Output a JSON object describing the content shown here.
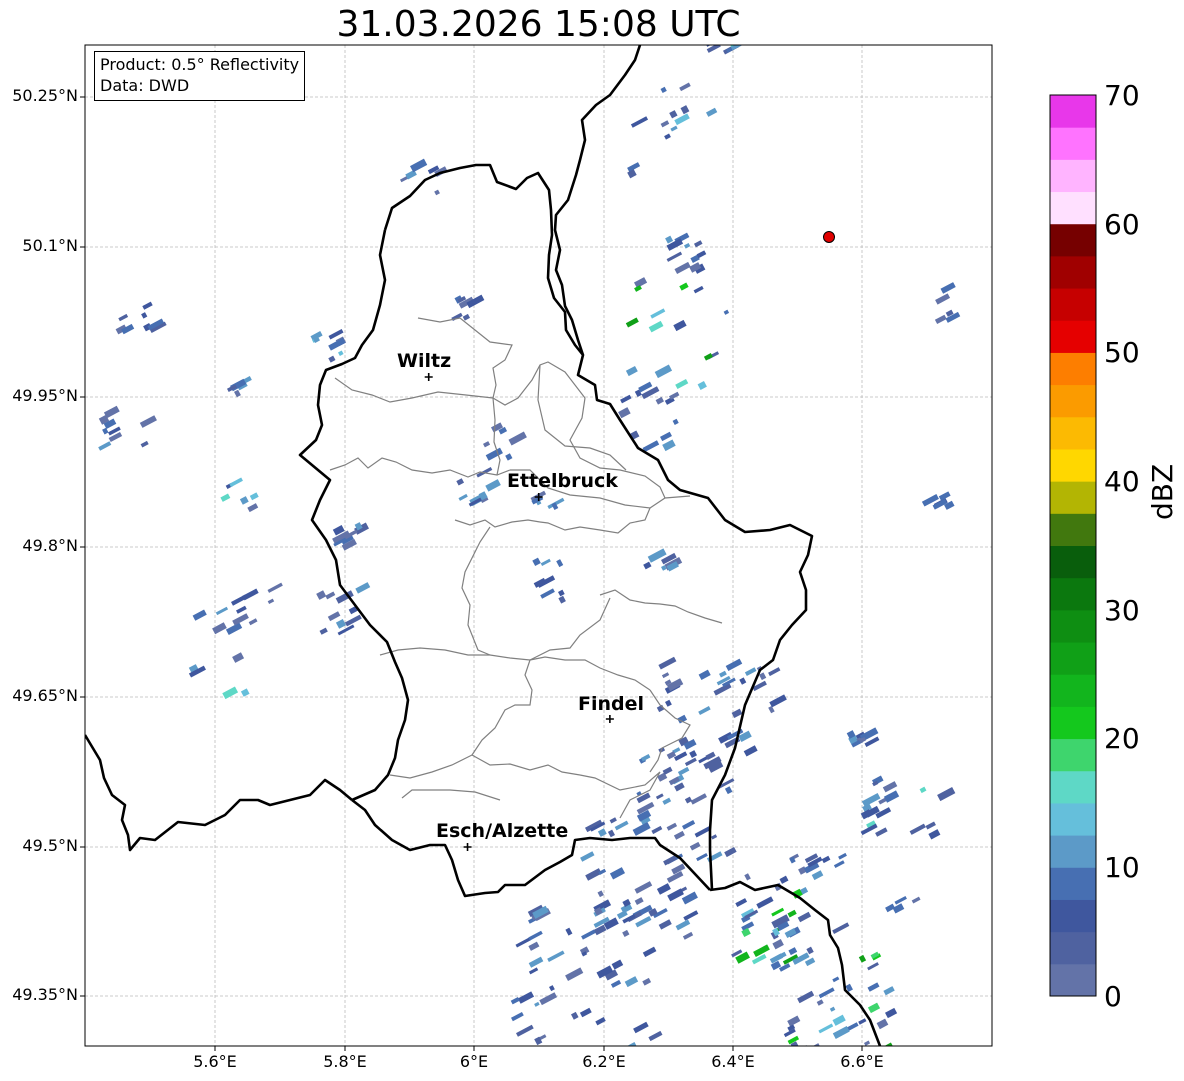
{
  "title": "31.03.2026 15:08 UTC",
  "info": {
    "line1": "Product: 0.5° Reflectivity",
    "line2": "Data: DWD"
  },
  "y_axis_labels": [
    "50.25°N",
    "50.1°N",
    "49.95°N",
    "49.8°N",
    "49.65°N",
    "49.5°N",
    "49.35°N"
  ],
  "x_axis_labels": [
    "5.6°E",
    "5.8°E",
    "6°E",
    "6.2°E",
    "6.4°E",
    "6.6°E"
  ],
  "cities": [
    {
      "name": "Wiltz",
      "lon": 5.93,
      "lat": 49.97
    },
    {
      "name": "Ettelbruck",
      "lon": 6.1,
      "lat": 49.85
    },
    {
      "name": "Findel",
      "lon": 6.21,
      "lat": 49.628
    },
    {
      "name": "Esch/Alzette",
      "lon": 5.99,
      "lat": 49.5
    }
  ],
  "radar_site": {
    "lon": 6.55,
    "lat": 50.11,
    "color": "#e00000"
  },
  "colorbar": {
    "label": "dBZ",
    "ticks": [
      "0",
      "10",
      "20",
      "30",
      "40",
      "50",
      "60",
      "70"
    ],
    "colors": [
      "#6373a8",
      "#4f62a0",
      "#3f579e",
      "#476fb2",
      "#5c9ac8",
      "#65bfdb",
      "#5ed8c6",
      "#3ed56d",
      "#14c81d",
      "#12b51d",
      "#10a017",
      "#0e8e12",
      "#0b780e",
      "#095e0c",
      "#41780e",
      "#b3b503",
      "#ffd700",
      "#fcba02",
      "#fb9b00",
      "#fd7e00",
      "#e50000",
      "#c60000",
      "#a00000",
      "#760000",
      "#ffe0ff",
      "#ffb4ff",
      "#ff73ff",
      "#e837ea"
    ]
  }
}
